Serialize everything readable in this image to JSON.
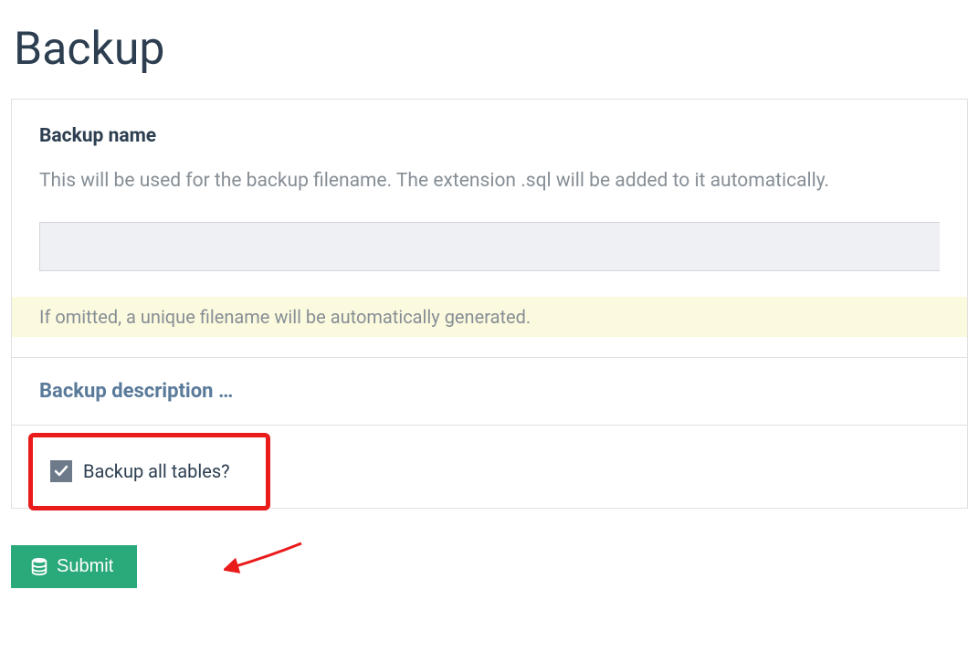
{
  "page": {
    "title": "Backup"
  },
  "form": {
    "backup_name": {
      "label": "Backup name",
      "help": "This will be used for the backup filename. The extension .sql will be added to it automatically.",
      "value": "",
      "note": "If omitted, a unique filename will be automatically generated."
    },
    "description_section": {
      "label": "Backup description …"
    },
    "backup_all": {
      "label": "Backup all tables?",
      "checked": true
    },
    "submit_label": "Submit"
  },
  "colors": {
    "accent_green": "#2aa97b",
    "annotation_red": "#e91b1b",
    "info_bg": "#fcfade",
    "heading_blue": "#5a7a9a"
  }
}
